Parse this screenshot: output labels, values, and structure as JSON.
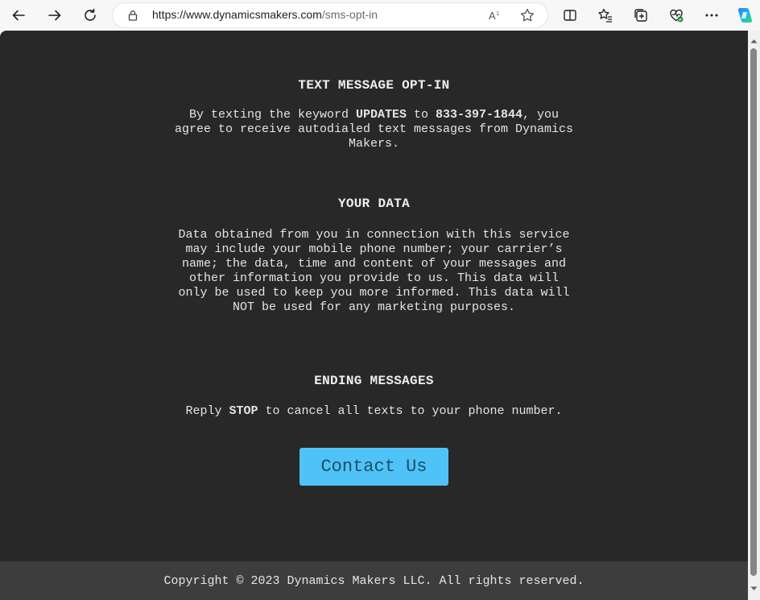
{
  "browser": {
    "url_host": "https://www.dynamicsmakers.com",
    "url_path": "/sms-opt-in",
    "icons": [
      "back-icon",
      "forward-icon",
      "refresh-icon",
      "lock-icon",
      "read-aloud-icon",
      "favorite-star-icon",
      "split-screen-icon",
      "favorites-icon",
      "collections-icon",
      "browser-essentials-icon",
      "more-icon",
      "copilot-icon"
    ]
  },
  "page": {
    "section1": {
      "heading": "TEXT MESSAGE OPT-IN",
      "text_a": "By texting the keyword ",
      "keyword": "UPDATES",
      "text_b": " to ",
      "phone": "833-397-1844",
      "text_c": ", you agree to receive autodialed text messages from Dynamics Makers."
    },
    "section2": {
      "heading": "YOUR DATA",
      "body": "Data obtained from you in connection with this service may include your mobile phone number; your carrier’s name; the data, time and content of your messages and other information you provide to us. This data will only be used to keep you more informed. This data will NOT be used for any marketing purposes."
    },
    "section3": {
      "heading": "ENDING MESSAGES",
      "text_a": "Reply ",
      "stop_word": "STOP",
      "text_b": " to cancel all texts to your phone number."
    },
    "contact_button": "Contact Us",
    "footer": "Copyright © 2023 Dynamics Makers LLC. All rights reserved."
  },
  "colors": {
    "page_bg": "#282828",
    "footer_bg": "#3d3d3d",
    "button_bg": "#4fc3f7",
    "button_text": "#1f4f66"
  }
}
